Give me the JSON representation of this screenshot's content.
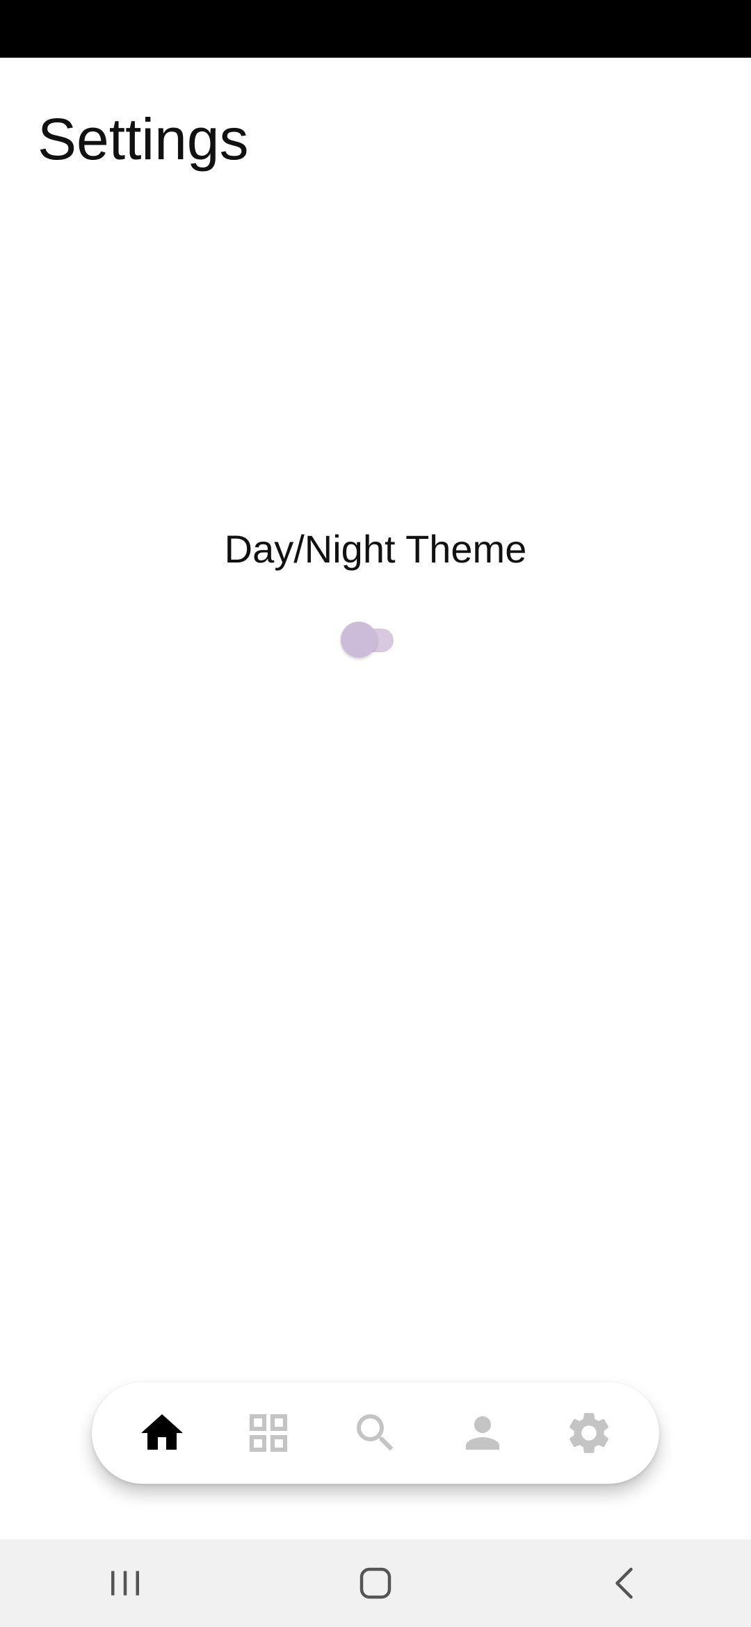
{
  "page": {
    "title": "Settings"
  },
  "theme_setting": {
    "label": "Day/Night Theme",
    "enabled": false,
    "accent_color": "#cdbcd9"
  },
  "bottom_nav": {
    "active_color": "#000000",
    "inactive_color": "#c4c4c4",
    "items": [
      {
        "icon": "home-icon",
        "active": true
      },
      {
        "icon": "grid-icon",
        "active": false
      },
      {
        "icon": "search-icon",
        "active": false
      },
      {
        "icon": "person-icon",
        "active": false
      },
      {
        "icon": "gear-icon",
        "active": false
      }
    ]
  },
  "system_nav": {
    "items": [
      {
        "icon": "recent-apps-icon"
      },
      {
        "icon": "home-outline-icon"
      },
      {
        "icon": "back-chevron-icon"
      }
    ]
  }
}
